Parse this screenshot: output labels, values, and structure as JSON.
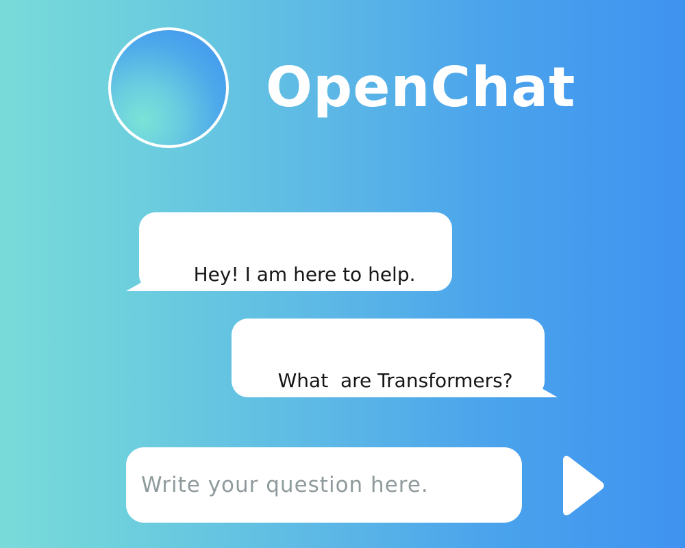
{
  "header": {
    "title": "OpenChat",
    "avatar_icon": "assistant-avatar"
  },
  "chat": {
    "messages": [
      {
        "role": "assistant",
        "text": "Hey! I am here to help."
      },
      {
        "role": "user",
        "text": "What  are Transformers?"
      }
    ]
  },
  "composer": {
    "placeholder": "Write your question here.",
    "value": "",
    "send_icon": "play-triangle-icon"
  },
  "theme": {
    "gradient_start": "#79dbd9",
    "gradient_end": "#3f93f0",
    "bubble_color": "#ffffff",
    "text_color": "#171717",
    "title_color": "#ffffff"
  }
}
